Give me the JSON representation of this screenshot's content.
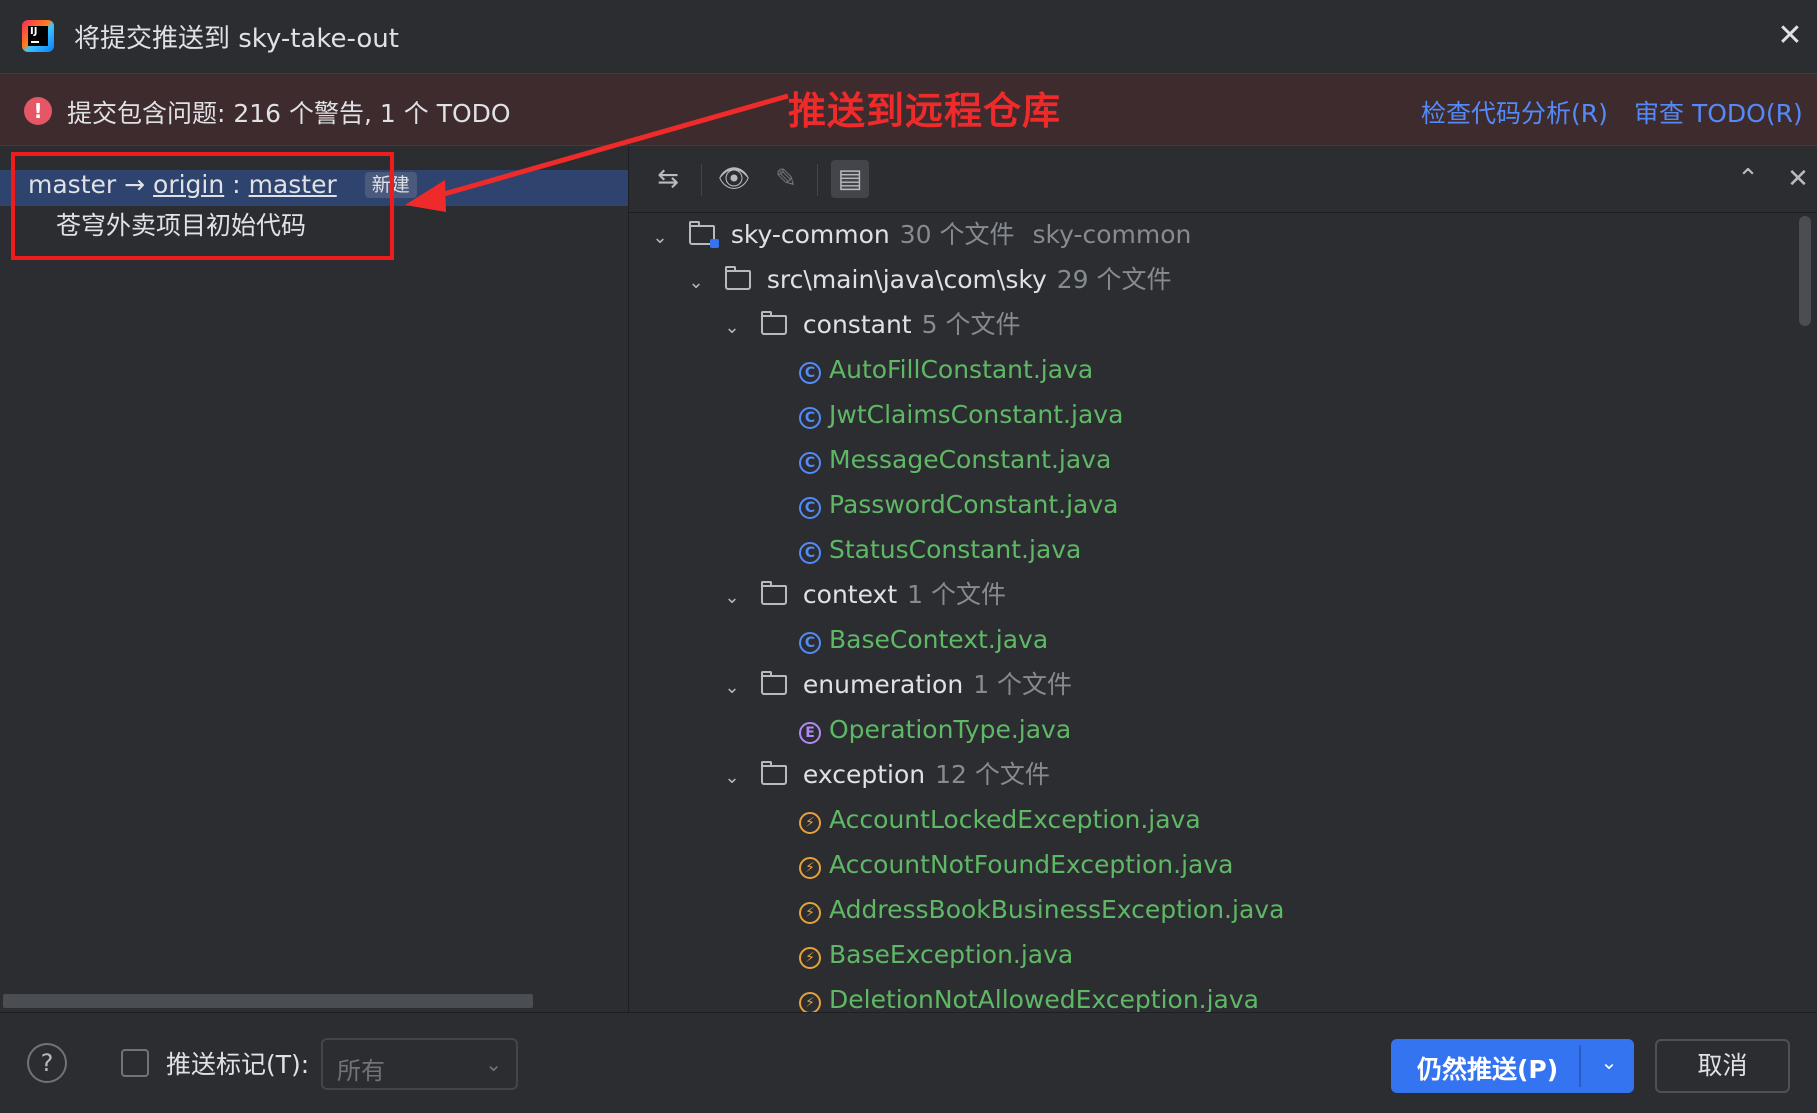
{
  "window": {
    "title": "将提交推送到 sky-take-out"
  },
  "warning": {
    "text": "提交包含问题: 216 个警告, 1 个 TODO",
    "link_analysis": "检查代码分析(R)",
    "link_todo": "审查 TODO(R)"
  },
  "annotation": {
    "text": "推送到远程仓库",
    "color": "#ee2a2a"
  },
  "commit": {
    "local_branch": "master",
    "arrow": "→",
    "remote": "origin",
    "separator": ":",
    "remote_branch": "master",
    "badge": "新建",
    "message": "苍穹外卖项目初始代码"
  },
  "tree": {
    "module": {
      "name": "sky-common",
      "count": "30 个文件",
      "extra": "sky-common"
    },
    "path": {
      "name": "src\\main\\java\\com\\sky",
      "count": "29 个文件"
    },
    "folders": [
      {
        "name": "constant",
        "count": "5 个文件"
      },
      {
        "name": "context",
        "count": "1 个文件"
      },
      {
        "name": "enumeration",
        "count": "1 个文件"
      },
      {
        "name": "exception",
        "count": "12 个文件"
      }
    ],
    "files": {
      "constant": [
        "AutoFillConstant.java",
        "JwtClaimsConstant.java",
        "MessageConstant.java",
        "PasswordConstant.java",
        "StatusConstant.java"
      ],
      "context": [
        "BaseContext.java"
      ],
      "enumeration": [
        "OperationType.java"
      ],
      "exception": [
        "AccountLockedException.java",
        "AccountNotFoundException.java",
        "AddressBookBusinessException.java",
        "BaseException.java",
        "DeletionNotAllowedException.java"
      ]
    },
    "icons": {
      "class": "C",
      "enum": "E",
      "exception": "⚡"
    }
  },
  "bottom": {
    "help": "?",
    "push_tags_label": "推送标记(T):",
    "tags_select_value": "所有",
    "push_button": "仍然推送(P)",
    "cancel_button": "取消"
  },
  "colors": {
    "accent": "#3574f0",
    "link": "#548af7",
    "new_file": "#5fb865",
    "selected_row": "#2e436e"
  }
}
